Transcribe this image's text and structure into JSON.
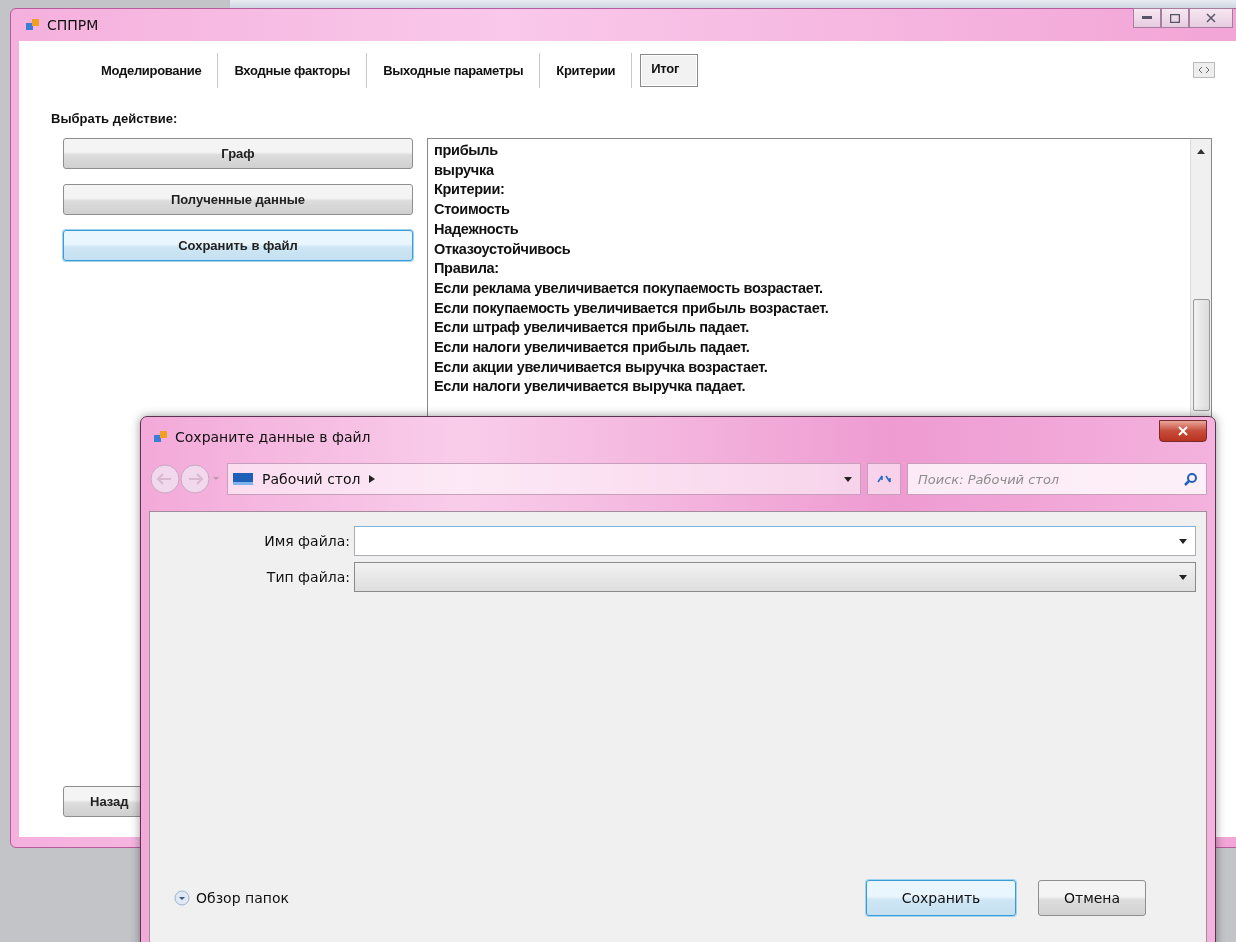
{
  "main_window": {
    "title": "СППРМ",
    "tabs": [
      {
        "label": "Моделирование",
        "selected": false
      },
      {
        "label": "Входные факторы",
        "selected": false
      },
      {
        "label": "Выходные параметры",
        "selected": false
      },
      {
        "label": "Критерии",
        "selected": false
      },
      {
        "label": "Итог",
        "selected": true
      }
    ],
    "group_label": "Выбрать действие:",
    "action_buttons": [
      {
        "label": "Граф",
        "focused": false
      },
      {
        "label": "Полученные данные",
        "focused": false
      },
      {
        "label": "Сохранить в файл",
        "focused": true
      }
    ],
    "output_lines": [
      "прибыль",
      "выручка",
      "Критерии:",
      "Стоимость",
      "Надежность",
      "Отказоустойчивось",
      "Правила:",
      "Если реклама увеличивается покупаемость  возрастает.",
      "Если покупаемость  увеличивается прибыль возрастает.",
      "Если штраф увеличивается прибыль падает.",
      "Если налоги увеличивается прибыль падает.",
      "Если акции увеличивается выручка возрастает.",
      "Если налоги увеличивается выручка падает."
    ],
    "back_button": "Назад"
  },
  "save_dialog": {
    "title": "Сохраните данные в файл",
    "location": "Рабочий стол",
    "search": {
      "placeholder": "Поиск: Рабочий стол"
    },
    "fields": [
      {
        "label": "Имя файла:",
        "kind": "editable"
      },
      {
        "label": "Тип файла:",
        "kind": "dropdown"
      }
    ],
    "browse_folders": "Обзор папок",
    "buttons": [
      {
        "label": "Сохранить",
        "default": true
      },
      {
        "label": "Отмена",
        "default": false
      }
    ]
  }
}
